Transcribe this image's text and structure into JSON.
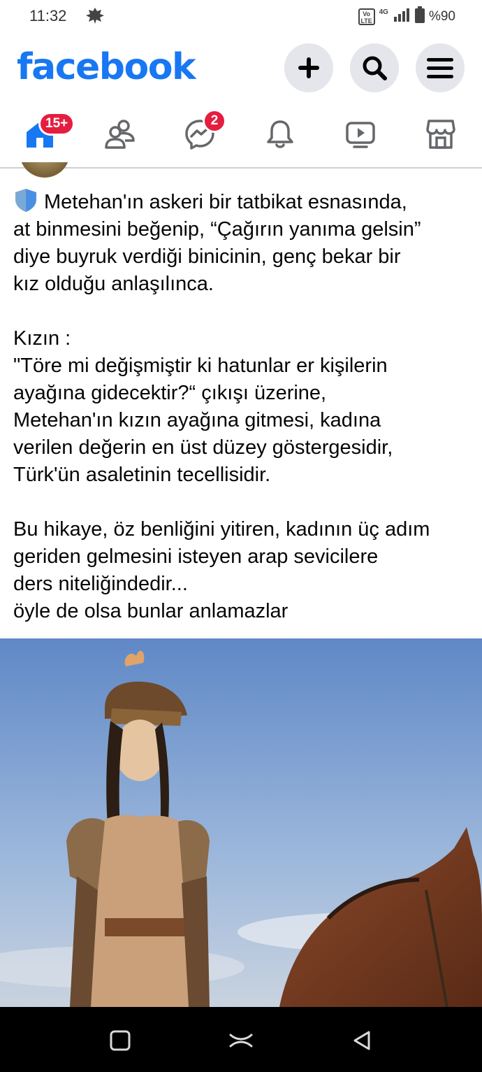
{
  "status_bar": {
    "time": "11:32",
    "volte": "Vo LTE",
    "network": "4G",
    "battery": "%90"
  },
  "header": {
    "logo": "facebook",
    "buttons": [
      "plus-icon",
      "search-icon",
      "menu-icon"
    ]
  },
  "tabs": [
    {
      "icon": "home-icon",
      "badge": "15+",
      "active": true
    },
    {
      "icon": "friends-icon",
      "badge": ""
    },
    {
      "icon": "messenger-icon",
      "badge": "2"
    },
    {
      "icon": "bell-icon",
      "badge": ""
    },
    {
      "icon": "video-icon",
      "badge": ""
    },
    {
      "icon": "marketplace-icon",
      "badge": ""
    }
  ],
  "post": {
    "paragraph1": "Metehan'ın askeri bir tatbikat esnasında,\nat binmesini beğenip, “Çağırın yanıma gelsin”\ndiye buyruk verdiği binicinin, genç bekar bir\nkız olduğu anlaşılınca.",
    "paragraph2": "Kızın :\n\"Töre mi değişmiştir ki hatunlar er kişilerin\nayağına gidecektir?“ çıkışı üzerine,\nMetehan'ın kızın ayağına gitmesi, kadına\nverilen değerin en üst düzey göstergesidir,\nTürk'ün asaletinin tecellisidir.",
    "paragraph3": "Bu hikaye, öz benliğini yitiren, kadının üç adım\ngeriden gelmesini isteyen arap sevicilere\nders niteliğindedir...\nöyle de olsa bunlar anlamazlar"
  },
  "colors": {
    "brand": "#1877f2",
    "badge": "#e41e3f",
    "button_bg": "#e4e6eb"
  }
}
